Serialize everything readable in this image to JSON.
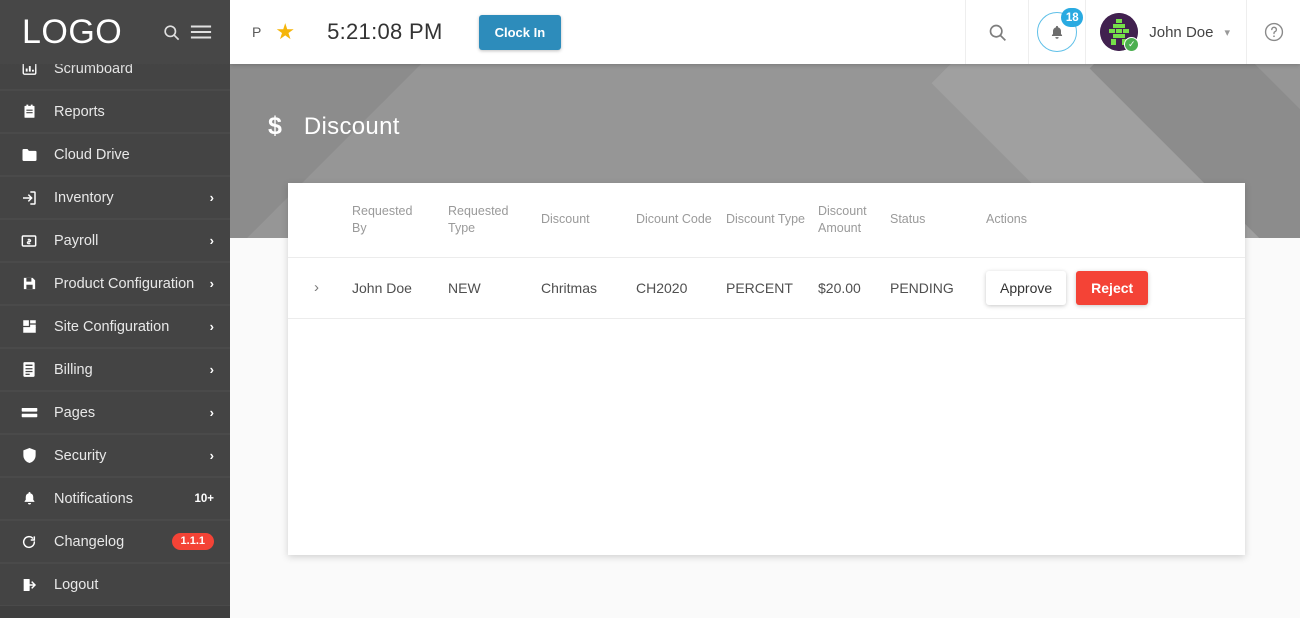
{
  "sidebar": {
    "logo": "LOGO",
    "search_icon": "search-icon",
    "menu_icon": "hamburger-menu-icon",
    "items": [
      {
        "label": "Scrumboard",
        "icon": "chart-bar-icon",
        "caret": "",
        "count": "",
        "badge": ""
      },
      {
        "label": "Reports",
        "icon": "clipboard-icon",
        "caret": "",
        "count": "",
        "badge": ""
      },
      {
        "label": "Cloud Drive",
        "icon": "folder-icon",
        "caret": "",
        "count": "",
        "badge": ""
      },
      {
        "label": "Inventory",
        "icon": "login-arrow-icon",
        "caret": "›",
        "count": "",
        "badge": ""
      },
      {
        "label": "Payroll",
        "icon": "money-card-icon",
        "caret": "›",
        "count": "",
        "badge": ""
      },
      {
        "label": "Product Configuration",
        "icon": "save-disk-icon",
        "caret": "›",
        "count": "",
        "badge": ""
      },
      {
        "label": "Site Configuration",
        "icon": "layout-grid-icon",
        "caret": "›",
        "count": "",
        "badge": ""
      },
      {
        "label": "Billing",
        "icon": "invoice-icon",
        "caret": "›",
        "count": "",
        "badge": ""
      },
      {
        "label": "Pages",
        "icon": "pages-lines-icon",
        "caret": "›",
        "count": "",
        "badge": ""
      },
      {
        "label": "Security",
        "icon": "shield-icon",
        "caret": "›",
        "count": "",
        "badge": ""
      },
      {
        "label": "Notifications",
        "icon": "bell-icon",
        "caret": "",
        "count": "10+",
        "badge": ""
      },
      {
        "label": "Changelog",
        "icon": "refresh-icon",
        "caret": "",
        "count": "",
        "badge": "1.1.1"
      },
      {
        "label": "Logout",
        "icon": "logout-arrow-icon",
        "caret": "",
        "count": "",
        "badge": ""
      }
    ]
  },
  "topbar": {
    "project_letter": "P",
    "star_icon": "star-icon",
    "time": "5:21:08 PM",
    "clock_in_label": "Clock In",
    "search_icon": "search-icon",
    "bell_icon": "bell-icon",
    "notification_count": "18",
    "avatar_icon": "identicon-avatar",
    "avatar_status_icon": "verified-check-icon",
    "user_name": "John Doe",
    "user_caret": "⌄",
    "help_icon": "help-circle-icon"
  },
  "page": {
    "icon": "$",
    "title": "Discount"
  },
  "table": {
    "headers": [
      "",
      "Requested By",
      "Requested Type",
      "Discount",
      "Dicount Code",
      "Discount Type",
      "Discount Amount",
      "Status",
      "Actions"
    ],
    "expand_icon": "chevron-right-icon",
    "rows": [
      {
        "requested_by": "John Doe",
        "requested_type": "NEW",
        "discount": "Chritmas",
        "discount_code": "CH2020",
        "discount_type": "PERCENT",
        "discount_amount": "$20.00",
        "status": "PENDING",
        "approve_label": "Approve",
        "reject_label": "Reject"
      }
    ]
  },
  "colors": {
    "sidebar_bg": "#444444",
    "accent_blue": "#2d8cbb",
    "badge_red": "#f44336",
    "badge_blue": "#29aae1",
    "banner_gray": "#969696",
    "star_gold": "#f5b50a"
  }
}
